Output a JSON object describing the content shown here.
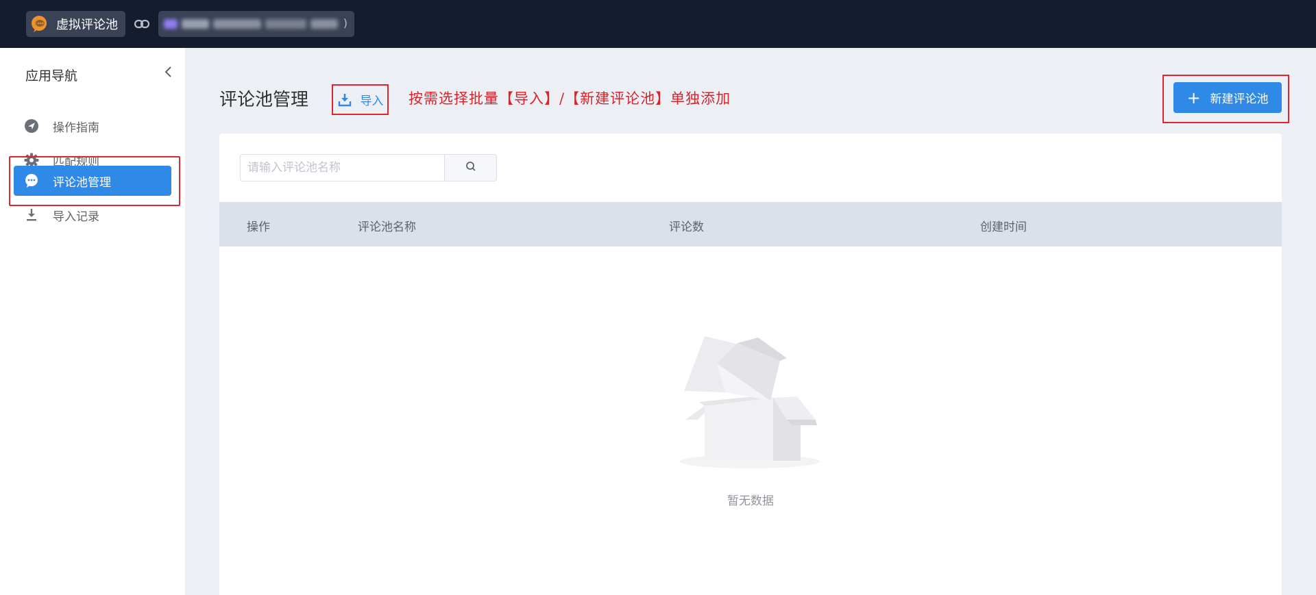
{
  "header": {
    "app_name": "虚拟评论池",
    "url_tail": ")"
  },
  "sidebar": {
    "title": "应用导航",
    "items": [
      {
        "label": "操作指南",
        "icon": "navigation-arrow-icon"
      },
      {
        "label": "匹配规则",
        "icon": "gear-icon"
      },
      {
        "label": "评论池管理",
        "icon": "chat-bubble-icon",
        "active": true
      },
      {
        "label": "导入记录",
        "icon": "download-icon"
      }
    ]
  },
  "main": {
    "page_title": "评论池管理",
    "import_label": "导入",
    "hint": "按需选择批量【导入】/【新建评论池】单独添加",
    "new_button_label": "新建评论池",
    "new_button_icon": "+",
    "search": {
      "placeholder": "请输入评论池名称",
      "value": ""
    },
    "table": {
      "columns": [
        "操作",
        "评论池名称",
        "评论数",
        "创建时间"
      ],
      "rows": [],
      "empty_text": "暂无数据"
    }
  },
  "colors": {
    "primary": "#2e8ae6",
    "topbar": "#161c30",
    "annotation_red": "#e1242b"
  }
}
